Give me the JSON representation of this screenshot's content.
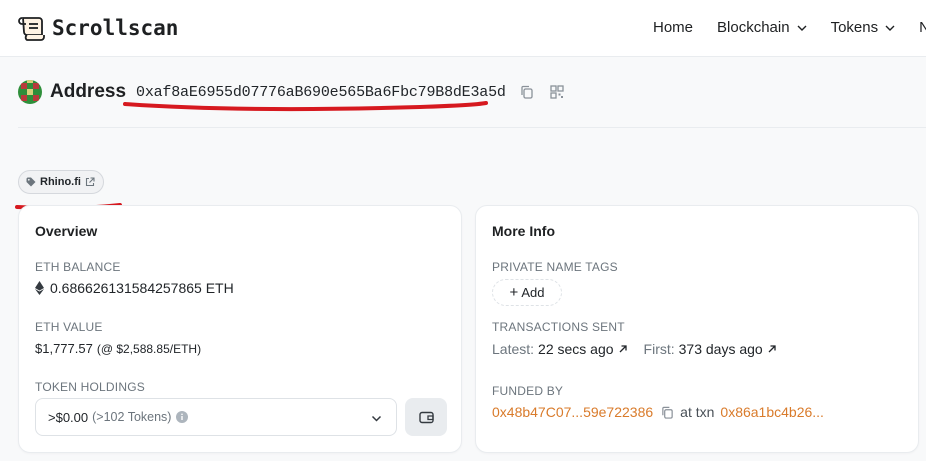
{
  "header": {
    "logo_text": "Scrollscan",
    "nav": [
      {
        "label": "Home",
        "has_dropdown": false
      },
      {
        "label": "Blockchain",
        "has_dropdown": true
      },
      {
        "label": "Tokens",
        "has_dropdown": true
      },
      {
        "label": "N",
        "has_dropdown": false
      }
    ]
  },
  "address": {
    "label": "Address",
    "value": "0xaf8aE6955d07776aB690e565Ba6Fbc79B8dE3a5d"
  },
  "tag": {
    "label": "Rhino.fi",
    "icon": "tag-icon",
    "link_icon": "external-link-icon"
  },
  "overview": {
    "title": "Overview",
    "eth_balance_label": "ETH BALANCE",
    "eth_balance_value": "0.686626131584257865 ETH",
    "eth_value_label": "ETH VALUE",
    "eth_value_amount": "$1,777.57",
    "eth_value_price": "(@ $2,588.85/ETH)",
    "token_holdings_label": "TOKEN HOLDINGS",
    "token_holdings_value": ">$0.00",
    "token_holdings_count": "(>102 Tokens)"
  },
  "more_info": {
    "title": "More Info",
    "private_tags_label": "PRIVATE NAME TAGS",
    "add_label": "Add",
    "transactions_label": "TRANSACTIONS SENT",
    "latest_label": "Latest:",
    "latest_value": "22 secs ago",
    "first_label": "First:",
    "first_value": "373 days ago",
    "funded_by_label": "FUNDED BY",
    "funded_by_address": "0x48b47C07...59e722386",
    "at_txn_label": "at txn",
    "funded_txn": "0x86a1bc4b26..."
  },
  "colors": {
    "link": "#d97b2b",
    "annotation": "#d6191f",
    "muted": "#6c757d"
  }
}
